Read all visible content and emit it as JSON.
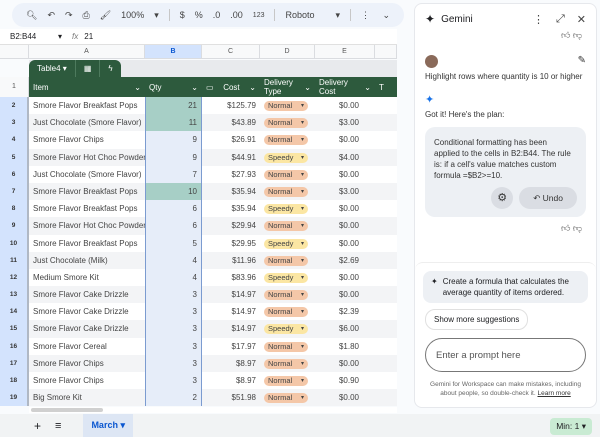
{
  "toolbar": {
    "zoom": "100%",
    "currency": "$",
    "percent": "%",
    "dec_decrease": ".0",
    "dec_increase": ".00",
    "number_format": "123",
    "font": "Roboto"
  },
  "formula_bar": {
    "name_box": "B2:B44",
    "fx": "fx",
    "value": "21"
  },
  "columns": [
    "A",
    "B",
    "C",
    "D",
    "E"
  ],
  "table": {
    "name": "Table4",
    "headers": [
      "Item",
      "Qty",
      "Cost",
      "Delivery Type",
      "Delivery Cost",
      "T"
    ],
    "rows": [
      {
        "n": "2",
        "item": "Smore Flavor Breakfast Pops",
        "qty": "21",
        "cost": "$125.79",
        "type": "Normal",
        "dcost": "$0.00",
        "hi": true
      },
      {
        "n": "3",
        "item": "Just Chocolate (Smore Flavor)",
        "qty": "11",
        "cost": "$43.89",
        "type": "Normal",
        "dcost": "$3.00",
        "hi": true
      },
      {
        "n": "4",
        "item": "Smore Flavor Chips",
        "qty": "9",
        "cost": "$26.91",
        "type": "Normal",
        "dcost": "$0.00"
      },
      {
        "n": "5",
        "item": "Smore Flavor Hot Choc Powder",
        "qty": "9",
        "cost": "$44.91",
        "type": "Speedy",
        "dcost": "$4.00"
      },
      {
        "n": "6",
        "item": "Just Chocolate (Smore Flavor)",
        "qty": "7",
        "cost": "$27.93",
        "type": "Normal",
        "dcost": "$0.00"
      },
      {
        "n": "7",
        "item": "Smore Flavor Breakfast Pops",
        "qty": "10",
        "cost": "$35.94",
        "type": "Normal",
        "dcost": "$3.00",
        "hi": true
      },
      {
        "n": "8",
        "item": "Smore Flavor Breakfast Pops",
        "qty": "6",
        "cost": "$35.94",
        "type": "Speedy",
        "dcost": "$0.00"
      },
      {
        "n": "9",
        "item": "Smore Flavor Hot Choc Powder",
        "qty": "6",
        "cost": "$29.94",
        "type": "Normal",
        "dcost": "$0.00"
      },
      {
        "n": "10",
        "item": "Smore Flavor Breakfast Pops",
        "qty": "5",
        "cost": "$29.95",
        "type": "Speedy",
        "dcost": "$0.00"
      },
      {
        "n": "11",
        "item": "Just Chocolate (Milk)",
        "qty": "4",
        "cost": "$11.96",
        "type": "Normal",
        "dcost": "$2.69"
      },
      {
        "n": "12",
        "item": "Medium Smore Kit",
        "qty": "4",
        "cost": "$83.96",
        "type": "Speedy",
        "dcost": "$0.00"
      },
      {
        "n": "13",
        "item": "Smore Flavor Cake Drizzle",
        "qty": "3",
        "cost": "$14.97",
        "type": "Normal",
        "dcost": "$0.00"
      },
      {
        "n": "14",
        "item": "Smore Flavor Cake Drizzle",
        "qty": "3",
        "cost": "$14.97",
        "type": "Normal",
        "dcost": "$2.39"
      },
      {
        "n": "15",
        "item": "Smore Flavor Cake Drizzle",
        "qty": "3",
        "cost": "$14.97",
        "type": "Speedy",
        "dcost": "$6.00"
      },
      {
        "n": "16",
        "item": "Smore Flavor Cereal",
        "qty": "3",
        "cost": "$17.97",
        "type": "Normal",
        "dcost": "$1.80"
      },
      {
        "n": "17",
        "item": "Smore Flavor Chips",
        "qty": "3",
        "cost": "$8.97",
        "type": "Normal",
        "dcost": "$0.00"
      },
      {
        "n": "18",
        "item": "Smore Flavor Chips",
        "qty": "3",
        "cost": "$8.97",
        "type": "Normal",
        "dcost": "$0.90"
      },
      {
        "n": "19",
        "item": "Big Smore Kit",
        "qty": "2",
        "cost": "$51.98",
        "type": "Normal",
        "dcost": "$0.00"
      }
    ]
  },
  "header_row_number": "1",
  "sheet_tab": "March",
  "status_chip": "Min: 1",
  "gemini": {
    "title": "Gemini",
    "user_msg": "Highlight rows where quantity is 10 or higher",
    "reply": "Got it! Here's the plan:",
    "card": "Conditional formatting has been applied to the cells in B2:B44. The rule is: if a cell's value matches custom formula =$B2>=10.",
    "undo": "Undo",
    "suggestion": "Create a formula that calculates the average quantity of items ordered.",
    "more": "Show more suggestions",
    "placeholder": "Enter a prompt here",
    "disclaimer": "Gemini for Workspace can make mistakes, including about people, so double-check it.",
    "learn_more": "Learn more"
  },
  "colors": {
    "table_header": "#2d5a3d",
    "highlight": "#a7cfc6",
    "normal_chip": "#f4c7a8",
    "speedy_chip": "#fbe6a3",
    "accent": "#0b57d0"
  }
}
